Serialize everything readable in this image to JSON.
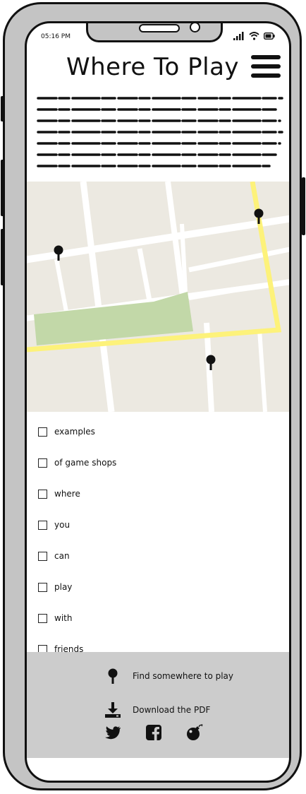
{
  "status_bar": {
    "time": "05:16 PM"
  },
  "header": {
    "title": "Where To Play"
  },
  "checklist": {
    "items": [
      {
        "label": "examples"
      },
      {
        "label": "of game shops"
      },
      {
        "label": "where"
      },
      {
        "label": "you"
      },
      {
        "label": "can"
      },
      {
        "label": "play"
      },
      {
        "label": "with"
      },
      {
        "label": "friends"
      }
    ]
  },
  "footer": {
    "find_label": "Find somewhere to play",
    "download_label": "Download the PDF"
  },
  "colors": {
    "map_background": "#ece9e1",
    "map_park": "#c2d8a8",
    "map_highlight_road": "#fdf27a",
    "footer_background": "#cccccc"
  },
  "icons": [
    "menu-icon",
    "map-pin-icon",
    "download-icon",
    "twitter-icon",
    "facebook-icon",
    "bomb-icon",
    "signal-icon",
    "wifi-icon",
    "battery-icon"
  ]
}
